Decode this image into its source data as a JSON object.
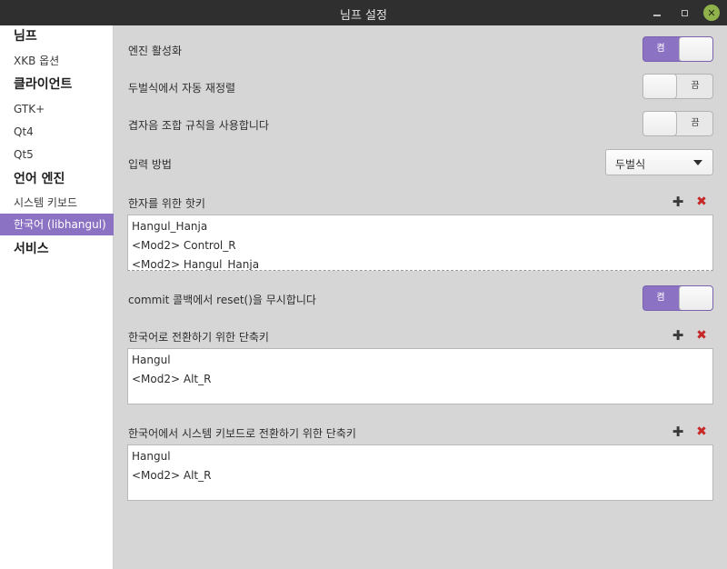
{
  "window": {
    "title": "님프 설정",
    "controls": {
      "minimize": "minimize-icon",
      "maximize": "maximize-icon",
      "close": "close-icon"
    }
  },
  "sidebar": {
    "items": [
      {
        "label": "님프",
        "type": "header"
      },
      {
        "label": "XKB 옵션",
        "type": "item"
      },
      {
        "label": "클라이언트",
        "type": "header"
      },
      {
        "label": "GTK+",
        "type": "item"
      },
      {
        "label": "Qt4",
        "type": "item"
      },
      {
        "label": "Qt5",
        "type": "item"
      },
      {
        "label": "언어 엔진",
        "type": "header"
      },
      {
        "label": "시스템 키보드",
        "type": "item"
      },
      {
        "label": "한국어 (libhangul)",
        "type": "item",
        "selected": true
      },
      {
        "label": "서비스",
        "type": "header"
      }
    ]
  },
  "settings": {
    "engine_active": {
      "label": "엔진 활성화",
      "state": "켬",
      "on": true
    },
    "auto_reorder": {
      "label": "두벌식에서 자동 재정렬",
      "state": "끔",
      "on": false
    },
    "compose_rule": {
      "label": "겹자음 조합 규칙을 사용합니다",
      "state": "끔",
      "on": false
    },
    "input_method": {
      "label": "입력 방법",
      "value": "두벌식"
    },
    "hanja_hotkeys": {
      "label": "한자를 위한 핫키",
      "items": [
        "Hangul_Hanja",
        "<Mod2> Control_R",
        "<Mod2> Hangul_Hanja"
      ]
    },
    "ignore_reset": {
      "label": "commit 콜백에서 reset()을 무시합니다",
      "state": "켬",
      "on": true
    },
    "korean_switch_keys": {
      "label": "한국어로 전환하기 위한 단축키",
      "items": [
        "Hangul",
        "<Mod2> Alt_R"
      ]
    },
    "system_switch_keys": {
      "label": "한국어에서 시스템 키보드로 전환하기 위한 단축키",
      "items": [
        "Hangul",
        "<Mod2> Alt_R"
      ]
    }
  },
  "icons": {
    "add": "add-icon",
    "remove": "remove-icon"
  },
  "colors": {
    "accent": "#8c72c3",
    "remove": "#c62828",
    "titlebar": "#2f2f2f",
    "close_button": "#8fb34a"
  }
}
